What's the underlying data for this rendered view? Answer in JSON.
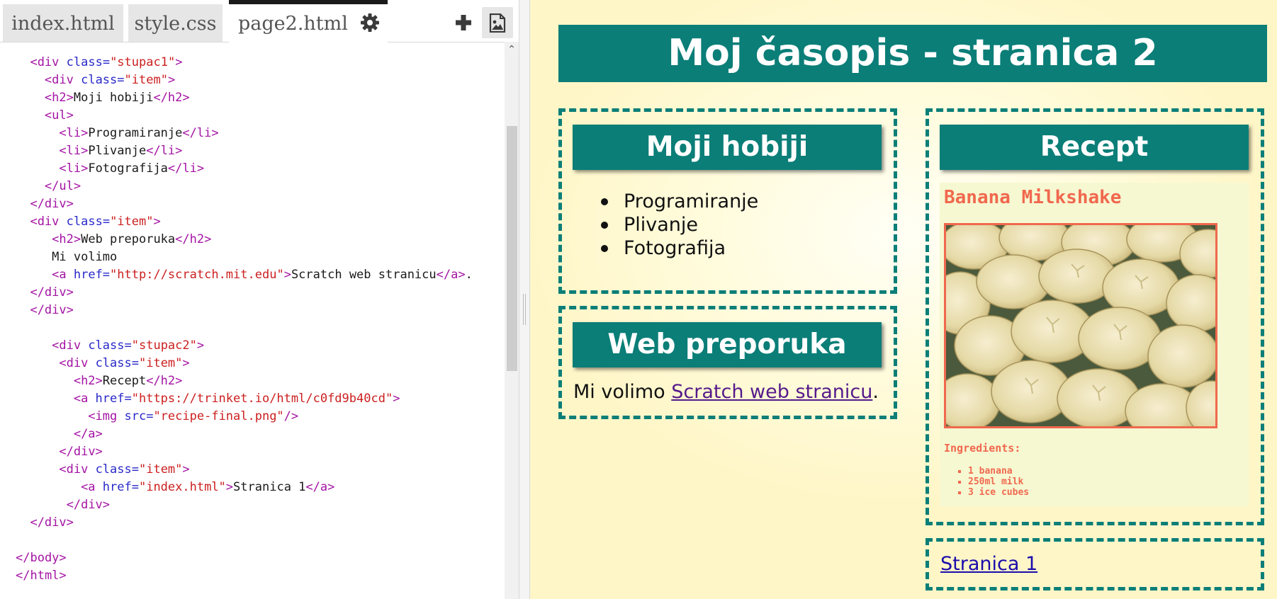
{
  "editor": {
    "tabs": [
      {
        "label": "index.html"
      },
      {
        "label": "style.css"
      },
      {
        "label": "page2.html"
      }
    ],
    "icons": [
      "gear-icon",
      "plus-icon",
      "image-icon"
    ],
    "code_lines": [
      {
        "indent": 2,
        "parts": [
          [
            "tag",
            "<div "
          ],
          [
            "attr",
            "class="
          ],
          [
            "str",
            "\"stupac1\""
          ],
          [
            "tag",
            ">"
          ]
        ]
      },
      {
        "indent": 4,
        "parts": [
          [
            "tag",
            "<div "
          ],
          [
            "attr",
            "class="
          ],
          [
            "str",
            "\"item\""
          ],
          [
            "tag",
            ">"
          ]
        ]
      },
      {
        "indent": 4,
        "parts": [
          [
            "tag",
            "<h2>"
          ],
          [
            "txt",
            "Moji hobiji"
          ],
          [
            "tag",
            "</h2>"
          ]
        ]
      },
      {
        "indent": 4,
        "parts": [
          [
            "tag",
            "<ul>"
          ]
        ]
      },
      {
        "indent": 6,
        "parts": [
          [
            "tag",
            "<li>"
          ],
          [
            "txt",
            "Programiranje"
          ],
          [
            "tag",
            "</li>"
          ]
        ]
      },
      {
        "indent": 6,
        "parts": [
          [
            "tag",
            "<li>"
          ],
          [
            "txt",
            "Plivanje"
          ],
          [
            "tag",
            "</li>"
          ]
        ]
      },
      {
        "indent": 6,
        "parts": [
          [
            "tag",
            "<li>"
          ],
          [
            "txt",
            "Fotografija"
          ],
          [
            "tag",
            "</li>"
          ]
        ]
      },
      {
        "indent": 4,
        "parts": [
          [
            "tag",
            "</ul>"
          ]
        ]
      },
      {
        "indent": 2,
        "parts": [
          [
            "tag",
            "</div>"
          ]
        ]
      },
      {
        "indent": 2,
        "parts": [
          [
            "tag",
            "<div "
          ],
          [
            "attr",
            "class="
          ],
          [
            "str",
            "\"item\""
          ],
          [
            "tag",
            ">"
          ]
        ]
      },
      {
        "indent": 5,
        "parts": [
          [
            "tag",
            "<h2>"
          ],
          [
            "txt",
            "Web preporuka"
          ],
          [
            "tag",
            "</h2>"
          ]
        ]
      },
      {
        "indent": 5,
        "parts": [
          [
            "txt",
            "Mi volimo"
          ]
        ]
      },
      {
        "indent": 5,
        "parts": [
          [
            "tag",
            "<a "
          ],
          [
            "attr",
            "href="
          ],
          [
            "str",
            "\"http://scratch.mit.edu\""
          ],
          [
            "tag",
            ">"
          ],
          [
            "txt",
            "Scratch web stranicu"
          ],
          [
            "tag",
            "</a>"
          ],
          [
            "txt",
            "."
          ]
        ]
      },
      {
        "indent": 2,
        "parts": [
          [
            "tag",
            "</div>"
          ]
        ]
      },
      {
        "indent": 2,
        "parts": [
          [
            "tag",
            "</div>"
          ]
        ]
      },
      {
        "indent": 0,
        "parts": []
      },
      {
        "indent": 5,
        "parts": [
          [
            "tag",
            "<div "
          ],
          [
            "attr",
            "class="
          ],
          [
            "str",
            "\"stupac2\""
          ],
          [
            "tag",
            ">"
          ]
        ]
      },
      {
        "indent": 6,
        "parts": [
          [
            "tag",
            "<div "
          ],
          [
            "attr",
            "class="
          ],
          [
            "str",
            "\"item\""
          ],
          [
            "tag",
            ">"
          ]
        ]
      },
      {
        "indent": 8,
        "parts": [
          [
            "tag",
            "<h2>"
          ],
          [
            "txt",
            "Recept"
          ],
          [
            "tag",
            "</h2>"
          ]
        ]
      },
      {
        "indent": 8,
        "parts": [
          [
            "tag",
            "<a "
          ],
          [
            "attr",
            "href="
          ],
          [
            "str",
            "\"https://trinket.io/html/c0fd9b40cd\""
          ],
          [
            "tag",
            ">"
          ]
        ]
      },
      {
        "indent": 10,
        "parts": [
          [
            "tag",
            "<img "
          ],
          [
            "attr",
            "src="
          ],
          [
            "str",
            "\"recipe-final.png\""
          ],
          [
            "tag",
            "/>"
          ]
        ]
      },
      {
        "indent": 8,
        "parts": [
          [
            "tag",
            "</a>"
          ]
        ]
      },
      {
        "indent": 6,
        "parts": [
          [
            "tag",
            "</div>"
          ]
        ]
      },
      {
        "indent": 6,
        "parts": [
          [
            "tag",
            "<div "
          ],
          [
            "attr",
            "class="
          ],
          [
            "str",
            "\"item\""
          ],
          [
            "tag",
            ">"
          ]
        ]
      },
      {
        "indent": 9,
        "parts": [
          [
            "tag",
            "<a "
          ],
          [
            "attr",
            "href="
          ],
          [
            "str",
            "\"index.html\""
          ],
          [
            "tag",
            ">"
          ],
          [
            "txt",
            "Stranica 1"
          ],
          [
            "tag",
            "</a>"
          ]
        ]
      },
      {
        "indent": 7,
        "parts": [
          [
            "tag",
            "</div>"
          ]
        ]
      },
      {
        "indent": 2,
        "parts": [
          [
            "tag",
            "</div>"
          ]
        ]
      },
      {
        "indent": 0,
        "parts": []
      },
      {
        "indent": 0,
        "parts": [
          [
            "tag",
            "</body>"
          ]
        ]
      },
      {
        "indent": 0,
        "parts": [
          [
            "tag",
            "</html>"
          ]
        ]
      }
    ],
    "colors": {
      "tag": "#a313a3",
      "attr": "#2929c9",
      "str": "#cc1f1f",
      "txt": "#1a1a1a"
    }
  },
  "preview": {
    "title": "Moj časopis - stranica 2",
    "hobbies": {
      "heading": "Moji hobiji",
      "items": [
        "Programiranje",
        "Plivanje",
        "Fotografija"
      ]
    },
    "web": {
      "heading": "Web preporuka",
      "text": "Mi volimo ",
      "link": "Scratch web stranicu",
      "suffix": "."
    },
    "recipe": {
      "heading": "Recept",
      "title": "Banana Milkshake",
      "ingredients_label": "Ingredients:",
      "ingredients": [
        "1 banana",
        "250ml milk",
        "3 ice cubes"
      ]
    },
    "nav": {
      "link": "Stranica 1"
    },
    "colors": {
      "teal": "#0b7e78",
      "coral": "#f0684e",
      "card": "#f6f8d2"
    }
  }
}
